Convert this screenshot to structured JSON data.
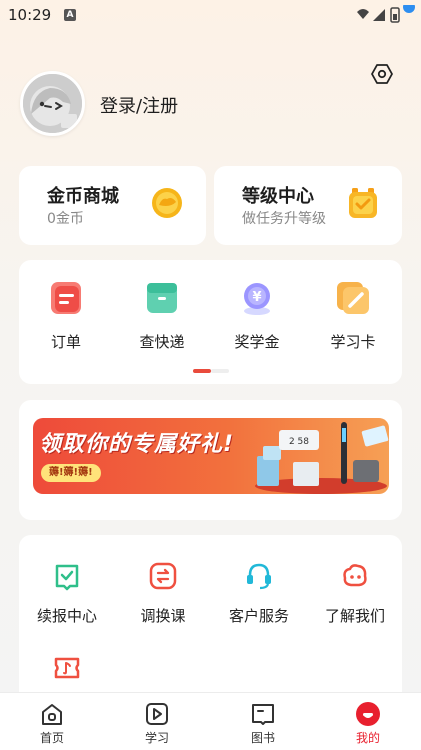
{
  "status_bar": {
    "time": "10:29",
    "indicator": "A"
  },
  "profile": {
    "login_label": "登录/注册"
  },
  "cards": {
    "coins": {
      "title": "金币商城",
      "subtitle": "0金币",
      "icon": "coin-icon"
    },
    "level": {
      "title": "等级中心",
      "subtitle": "做任务升等级",
      "icon": "badge-icon"
    }
  },
  "quick_menu": [
    {
      "label": "订单",
      "icon": "order-icon"
    },
    {
      "label": "查快递",
      "icon": "package-icon"
    },
    {
      "label": "奖学金",
      "icon": "scholarship-icon"
    },
    {
      "label": "学习卡",
      "icon": "study-card-icon"
    }
  ],
  "quick_menu_page": {
    "current": 1,
    "total": 2
  },
  "banner": {
    "title": "领取你的专属好礼!",
    "pill": "薅!薅!薅!",
    "device_readout": "2 58"
  },
  "services": [
    {
      "label": "续报中心",
      "icon": "renew-icon"
    },
    {
      "label": "调换课",
      "icon": "swap-icon"
    },
    {
      "label": "客户服务",
      "icon": "headset-icon"
    },
    {
      "label": "了解我们",
      "icon": "about-icon"
    },
    {
      "label": "",
      "icon": "ticket-icon"
    }
  ],
  "tabbar": [
    {
      "label": "首页",
      "icon": "home-icon",
      "active": false
    },
    {
      "label": "学习",
      "icon": "play-icon",
      "active": false
    },
    {
      "label": "图书",
      "icon": "book-icon",
      "active": false
    },
    {
      "label": "我的",
      "icon": "profile-icon",
      "active": true
    }
  ],
  "colors": {
    "accent": "#e8202e",
    "pager_active": "#e94b3c",
    "service_green": "#2fbf8a",
    "service_red": "#ef5040",
    "service_cyan": "#21b8d8"
  }
}
